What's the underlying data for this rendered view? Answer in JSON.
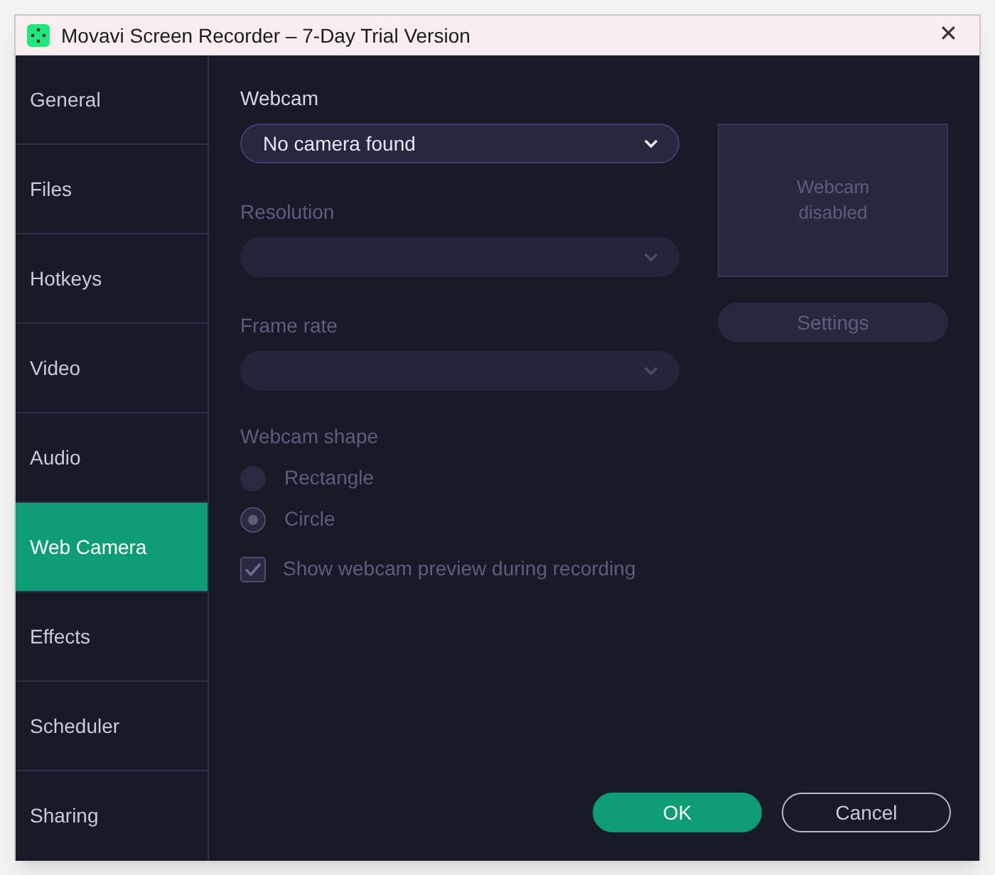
{
  "window": {
    "title": "Movavi Screen Recorder – 7-Day Trial Version",
    "close": "✕"
  },
  "sidebar": {
    "items": [
      {
        "label": "General",
        "selected": false
      },
      {
        "label": "Files",
        "selected": false
      },
      {
        "label": "Hotkeys",
        "selected": false
      },
      {
        "label": "Video",
        "selected": false
      },
      {
        "label": "Audio",
        "selected": false
      },
      {
        "label": "Web Camera",
        "selected": true
      },
      {
        "label": "Effects",
        "selected": false
      },
      {
        "label": "Scheduler",
        "selected": false
      },
      {
        "label": "Sharing",
        "selected": false
      }
    ]
  },
  "dropdowns": [
    {
      "label": "Webcam",
      "value": "No camera found",
      "disabled": false
    },
    {
      "label": "Resolution",
      "disabled": true
    },
    {
      "label": "Frame rate",
      "disabled": true
    }
  ],
  "preview": {
    "text": "Webcam disabled"
  },
  "settings_button": {
    "label": "Settings",
    "disabled": true
  },
  "shape": {
    "label": "Webcam shape",
    "disabled": true,
    "options": [
      {
        "label": "Rectangle",
        "selected": false
      },
      {
        "label": "Circle",
        "selected": true
      }
    ]
  },
  "show_preview": {
    "label": "Show webcam preview during recording",
    "checked": true,
    "disabled": true
  },
  "buttons": [
    {
      "label": "OK",
      "kind": "primary"
    },
    {
      "label": "Cancel",
      "kind": "secondary"
    }
  ]
}
